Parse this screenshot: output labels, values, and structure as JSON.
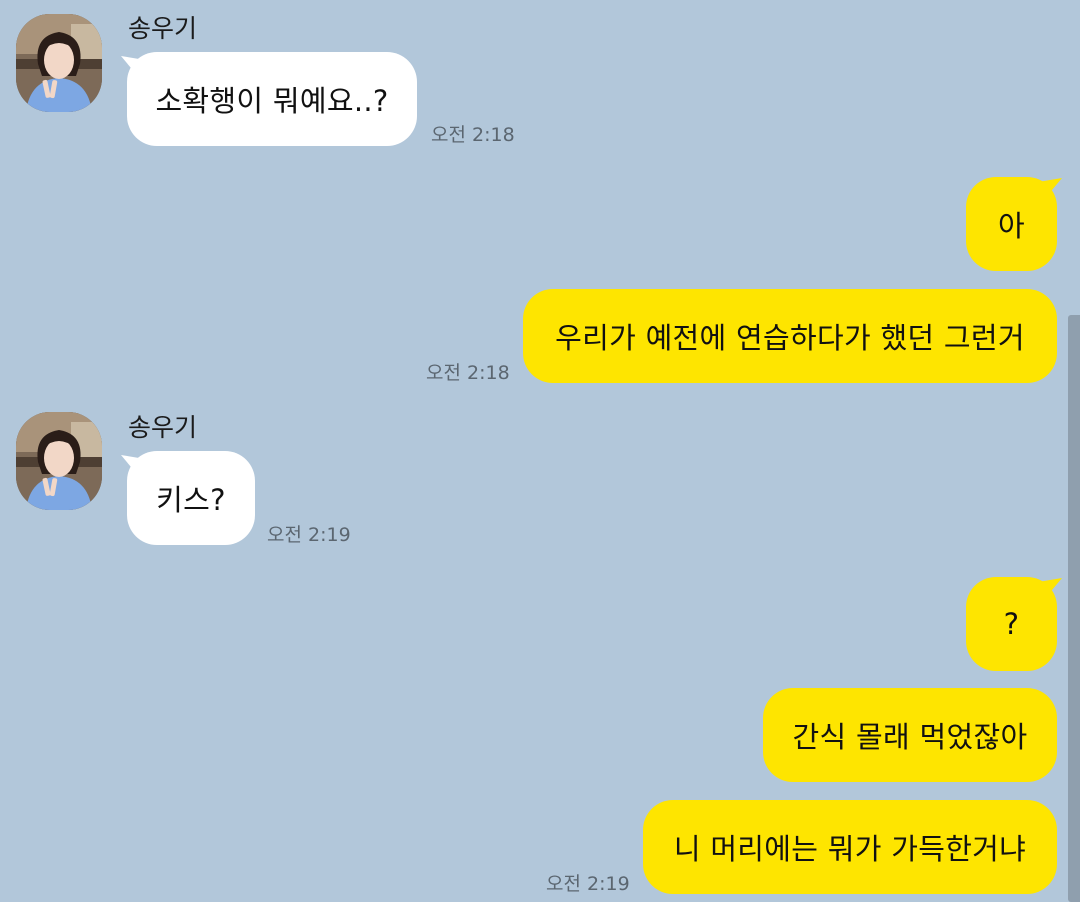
{
  "colors": {
    "background": "#b2c7da",
    "incoming_bubble": "#ffffff",
    "outgoing_bubble": "#fee500",
    "timestamp": "#5b6670"
  },
  "messages": [
    {
      "sender": "송우기",
      "text": "소확행이 뭐예요..?",
      "time": "오전 2:18",
      "direction": "incoming"
    },
    {
      "text": "아",
      "direction": "outgoing"
    },
    {
      "text": "우리가 예전에 연습하다가 했던 그런거",
      "time": "오전 2:18",
      "direction": "outgoing"
    },
    {
      "sender": "송우기",
      "text": "키스?",
      "time": "오전 2:19",
      "direction": "incoming"
    },
    {
      "text": "?",
      "direction": "outgoing"
    },
    {
      "text": "간식 몰래 먹었잖아",
      "direction": "outgoing"
    },
    {
      "text": "니 머리에는 뭐가 가득한거냐",
      "time": "오전 2:19",
      "direction": "outgoing"
    }
  ],
  "icons": {
    "avatar": "profile-photo-icon"
  }
}
